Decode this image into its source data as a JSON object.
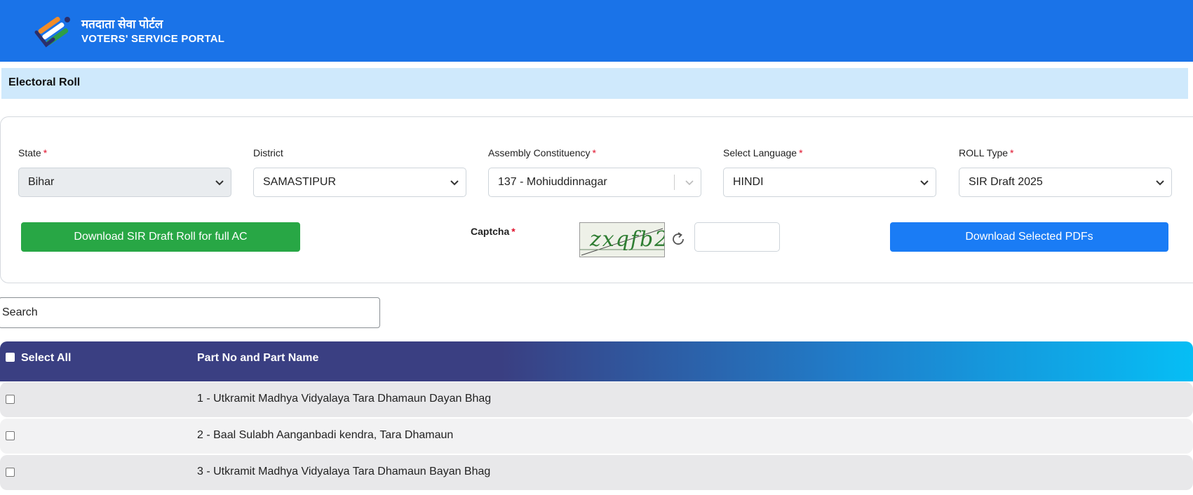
{
  "header": {
    "brand_hindi": "मतदाता सेवा पोर्टल",
    "brand_english": "VOTERS' SERVICE PORTAL",
    "logo_icon": "ballot-logo-icon",
    "background_color": "#1a73e8"
  },
  "section": {
    "title": "Electoral Roll"
  },
  "filters": {
    "required_mark": "*",
    "state": {
      "label": "State",
      "value": "Bihar",
      "disabled": true
    },
    "district": {
      "label": "District",
      "value": "SAMASTIPUR"
    },
    "assembly": {
      "label": "Assembly Constituency",
      "value": "137 - Mohiuddinnagar"
    },
    "language": {
      "label": "Select Language",
      "value": "HINDI"
    },
    "roll_type": {
      "label": "ROLL Type",
      "value": "SIR Draft 2025"
    }
  },
  "actions": {
    "download_full_label": "Download SIR Draft Roll for full AC",
    "download_selected_label": "Download Selected PDFs",
    "captcha_label": "Captcha",
    "captcha_text": "zxqfb2",
    "refresh_icon": "refresh-icon"
  },
  "search": {
    "placeholder": "Search"
  },
  "table": {
    "select_all_label": "Select All",
    "column_part": "Part No and Part Name",
    "rows": [
      {
        "text": "1 - Utkramit Madhya Vidyalaya Tara Dhamaun Dayan Bhag"
      },
      {
        "text": "2 - Baal Sulabh Aanganbadi kendra, Tara Dhamaun"
      },
      {
        "text": "3 - Utkramit Madhya Vidyalaya Tara Dhamaun Bayan Bhag"
      }
    ]
  }
}
